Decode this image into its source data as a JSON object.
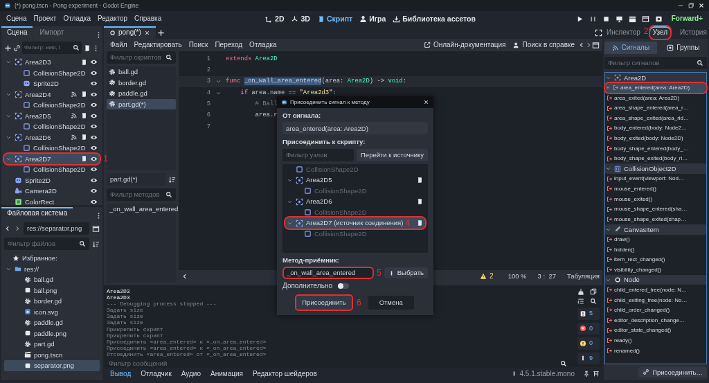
{
  "window": {
    "title": "(*) pong.tscn - Pong experiment - Godot Engine"
  },
  "menu": [
    "Сцена",
    "Проект",
    "Отладка",
    "Редактор",
    "Справка"
  ],
  "workspaces": [
    {
      "label": "2D",
      "kind": "flat",
      "selected": false
    },
    {
      "label": "3D",
      "kind": "spatial",
      "selected": false
    },
    {
      "label": "Скрипт",
      "kind": "script",
      "selected": true
    },
    {
      "label": "Игра",
      "kind": "game",
      "selected": false
    },
    {
      "label": "Библиотека ассетов",
      "kind": "assetlib",
      "selected": false
    }
  ],
  "renderer": "Forward+",
  "scene_dock": {
    "tabs": [
      {
        "label": "Сцена",
        "selected": true
      },
      {
        "label": "Импорт",
        "selected": false
      }
    ],
    "filter_placeholder": "Фильтр: имя, t",
    "tree": [
      {
        "name": "Area2D3",
        "kind": "area",
        "script": true,
        "signals": false,
        "selected": false,
        "circled": false,
        "expanded": true,
        "children": [
          {
            "name": "CollisionShape2D",
            "kind": "collision",
            "script": false,
            "signals": false,
            "selected": false,
            "circled": false
          },
          {
            "name": "Sprite2D",
            "kind": "sprite",
            "script": false,
            "signals": false,
            "selected": false,
            "circled": false
          }
        ]
      },
      {
        "name": "Area2D4",
        "kind": "area",
        "script": true,
        "signals": true,
        "selected": false,
        "circled": false,
        "expanded": true,
        "children": [
          {
            "name": "CollisionShape2D",
            "kind": "collision",
            "script": false,
            "signals": false,
            "selected": false,
            "circled": false
          }
        ]
      },
      {
        "name": "Area2D5",
        "kind": "area",
        "script": true,
        "signals": true,
        "selected": false,
        "circled": false,
        "expanded": true,
        "children": [
          {
            "name": "CollisionShape2D",
            "kind": "collision",
            "script": false,
            "signals": false,
            "selected": false,
            "circled": false
          }
        ]
      },
      {
        "name": "Area2D6",
        "kind": "area",
        "script": true,
        "signals": true,
        "selected": false,
        "circled": false,
        "expanded": true,
        "children": [
          {
            "name": "CollisionShape2D",
            "kind": "collision",
            "script": false,
            "signals": false,
            "selected": false,
            "circled": false
          }
        ]
      },
      {
        "name": "Area2D7",
        "kind": "area",
        "script": true,
        "signals": false,
        "selected": true,
        "circled": true,
        "annotation": "1",
        "expanded": true,
        "children": [
          {
            "name": "CollisionShape2D",
            "kind": "collision",
            "script": false,
            "signals": false,
            "selected": false,
            "circled": false
          }
        ]
      },
      {
        "name": "Sprite2D",
        "kind": "sprite",
        "script": false,
        "signals": false,
        "selected": false,
        "circled": false
      },
      {
        "name": "Camera2D",
        "kind": "camera",
        "script": false,
        "signals": false,
        "selected": false,
        "circled": false
      },
      {
        "name": "ColorRect",
        "kind": "colorrect",
        "script": false,
        "signals": false,
        "selected": false,
        "circled": false
      }
    ]
  },
  "filesystem": {
    "tab": "Файловая система",
    "path": "res://separator.png",
    "filter_placeholder": "Фильтр файлов",
    "favorites": "Избранное:",
    "tree": [
      {
        "name": "res://",
        "kind": "folder",
        "selected": false,
        "expanded": true,
        "children": [
          {
            "name": "ball.gd",
            "kind": "script",
            "selected": false
          },
          {
            "name": "ball.png",
            "kind": "image",
            "selected": false
          },
          {
            "name": "border.gd",
            "kind": "script",
            "selected": false
          },
          {
            "name": "icon.svg",
            "kind": "svg",
            "selected": false
          },
          {
            "name": "paddle.gd",
            "kind": "script",
            "selected": false
          },
          {
            "name": "paddle.png",
            "kind": "image",
            "selected": false
          },
          {
            "name": "part.gd",
            "kind": "script",
            "selected": false
          },
          {
            "name": "pong.tscn",
            "kind": "scene",
            "selected": false
          },
          {
            "name": "separator.png",
            "kind": "image",
            "selected": true
          }
        ]
      }
    ]
  },
  "editor_tabs": [
    {
      "label": "pong(*)",
      "selected": true
    }
  ],
  "script_menu": [
    "Файл",
    "Редактировать",
    "Поиск",
    "Переход",
    "Отладка"
  ],
  "help_links": [
    {
      "label": "Онлайн-документация",
      "kind": "docs"
    },
    {
      "label": "Поиск в справке",
      "kind": "search"
    }
  ],
  "script_list": {
    "filter_placeholder": "Фильтр скриптов",
    "files": [
      {
        "name": "ball.gd",
        "selected": false
      },
      {
        "name": "border.gd",
        "selected": false
      },
      {
        "name": "paddle.gd",
        "selected": false
      },
      {
        "name": "part.gd(*)",
        "selected": true
      }
    ],
    "current": "part.gd(*)",
    "method_filter_placeholder": "Фильтр методов",
    "methods": [
      "_on_wall_area_entered"
    ]
  },
  "code": [
    {
      "number": "1",
      "current": false,
      "foldable": false,
      "tokens": [
        {
          "text": "extends ",
          "kind": "keyword"
        },
        {
          "text": "Area2D",
          "kind": "type"
        }
      ]
    },
    {
      "number": "2",
      "current": false,
      "foldable": false
    },
    {
      "number": "3",
      "current": true,
      "foldable": true,
      "tokens": [
        {
          "text": "func ",
          "kind": "keyword"
        },
        {
          "text": "_on_wall_area_entered",
          "kind": "selection"
        },
        {
          "text": "(area: ",
          "kind": "plain"
        },
        {
          "text": "Area2D",
          "kind": "type"
        },
        {
          "text": ") -> ",
          "kind": "plain"
        },
        {
          "text": "void",
          "kind": "type"
        },
        {
          "text": ":",
          "kind": "plain"
        }
      ]
    },
    {
      "number": "4",
      "current": false,
      "foldable": true,
      "tokens": [
        {
          "text": "\tif",
          "kind": "control"
        },
        {
          "text": " area.name == ",
          "kind": "plain"
        },
        {
          "text": "\"Area2d3\"",
          "kind": "string"
        },
        {
          "text": ":",
          "kind": "plain"
        }
      ]
    },
    {
      "number": "5",
      "current": false,
      "foldable": false,
      "tokens": [
        {
          "text": "\t\t# Ball",
          "kind": "comment"
        }
      ]
    },
    {
      "number": "6",
      "current": false,
      "foldable": false,
      "tokens": [
        {
          "text": "\t\tarea.r",
          "kind": "plain"
        }
      ]
    },
    {
      "number": "7",
      "current": false,
      "foldable": false
    }
  ],
  "status": {
    "warnings": "2",
    "zoom": "100 %",
    "position": "3 :  27",
    "indent": "Табуляция"
  },
  "output": {
    "lines": [
      {
        "text": "Area2D3",
        "kind": "print"
      },
      {
        "text": "Area2D3",
        "kind": "print"
      },
      {
        "text": "--- Debugging process stopped ---",
        "kind": "editor"
      },
      {
        "text": "Задать size",
        "kind": "editor"
      },
      {
        "text": "Задать size",
        "kind": "editor"
      },
      {
        "text": "Задать size",
        "kind": "editor"
      },
      {
        "text": "Прикрепить скрипт",
        "kind": "editor"
      },
      {
        "text": "Прикрепить скрипт",
        "kind": "editor"
      },
      {
        "text": "Присоединить «area_entered» к «_on_area_entered»",
        "kind": "editor"
      },
      {
        "text": "Присоединить «area_entered» к «_on_area_entered»",
        "kind": "editor"
      },
      {
        "text": "Отсоединить «area_entered» от «_on_area_entered»",
        "kind": "editor"
      }
    ],
    "filter_placeholder": "Фильтр сообщений",
    "counters": [
      {
        "kind": "message",
        "count": "5"
      },
      {
        "kind": "error",
        "count": "0"
      },
      {
        "kind": "warning",
        "count": "0"
      },
      {
        "kind": "editor",
        "count": "9"
      }
    ]
  },
  "bottom_tabs": [
    {
      "label": "Вывод",
      "selected": true
    },
    {
      "label": "Отладчик",
      "selected": false
    },
    {
      "label": "Аудио",
      "selected": false
    },
    {
      "label": "Анимация",
      "selected": false
    },
    {
      "label": "Редактор шейдеров",
      "selected": false
    }
  ],
  "version": "4.5.1.stable.mono",
  "right_dock": {
    "tabs": [
      {
        "label": "Инспектор",
        "selected": false,
        "circled": false
      },
      {
        "label": "Узел",
        "selected": true,
        "circled": true,
        "annotation": "2"
      },
      {
        "label": "История",
        "selected": false,
        "circled": false
      }
    ],
    "subtabs": [
      {
        "label": "Сигналы",
        "kind": "signals",
        "selected": true
      },
      {
        "label": "Группы",
        "kind": "groups",
        "selected": false
      }
    ],
    "filter_placeholder": "Фильтр сигналов",
    "groups": [
      {
        "name": "Area2D",
        "kind": "area",
        "expanded": true,
        "signals": [
          {
            "label": "area_entered(area: Area2D)",
            "selected": true,
            "connected": true,
            "circled": true
          },
          {
            "label": "area_exited(area: Area2D)",
            "selected": false,
            "connected": false,
            "circled": false
          },
          {
            "label": "area_shape_entered(area_r…",
            "selected": false,
            "connected": false,
            "circled": false
          },
          {
            "label": "area_shape_exited(area_rid…",
            "selected": false,
            "connected": false,
            "circled": false
          },
          {
            "label": "body_entered(body: Node2…",
            "selected": false,
            "connected": false,
            "circled": false
          },
          {
            "label": "body_exited(body: Node2D)",
            "selected": false,
            "connected": false,
            "circled": false
          },
          {
            "label": "body_shape_entered(body_…",
            "selected": false,
            "connected": false,
            "circled": false
          },
          {
            "label": "body_shape_exited(body_ri…",
            "selected": false,
            "connected": false,
            "circled": false
          }
        ]
      },
      {
        "name": "CollisionObject2D",
        "kind": "collisionobject",
        "expanded": true,
        "signals": [
          {
            "label": "input_event(viewport: Nod…",
            "selected": false,
            "connected": false,
            "circled": false
          },
          {
            "label": "mouse_entered()",
            "selected": false,
            "connected": false,
            "circled": false
          },
          {
            "label": "mouse_exited()",
            "selected": false,
            "connected": false,
            "circled": false
          },
          {
            "label": "mouse_shape_entered(sha…",
            "selected": false,
            "connected": false,
            "circled": false
          },
          {
            "label": "mouse_shape_exited(shap…",
            "selected": false,
            "connected": false,
            "circled": false
          }
        ]
      },
      {
        "name": "CanvasItem",
        "kind": "canvasitem",
        "expanded": true,
        "signals": [
          {
            "label": "draw()",
            "selected": false,
            "connected": false,
            "circled": false
          },
          {
            "label": "hidden()",
            "selected": false,
            "connected": false,
            "circled": false
          },
          {
            "label": "item_rect_changed()",
            "selected": false,
            "connected": false,
            "circled": false
          },
          {
            "label": "visibility_changed()",
            "selected": false,
            "connected": false,
            "circled": false
          }
        ]
      },
      {
        "name": "Node",
        "kind": "node",
        "expanded": true,
        "signals": [
          {
            "label": "child_entered_tree(node: N…",
            "selected": false,
            "connected": false,
            "circled": false
          },
          {
            "label": "child_exiting_tree(node: No…",
            "selected": false,
            "connected": false,
            "circled": false
          },
          {
            "label": "child_order_changed()",
            "selected": false,
            "connected": false,
            "circled": false
          },
          {
            "label": "editor_description_change…",
            "selected": false,
            "connected": false,
            "circled": false
          },
          {
            "label": "editor_state_changed()",
            "selected": false,
            "connected": false,
            "circled": false
          },
          {
            "label": "ready()",
            "selected": false,
            "connected": false,
            "circled": false
          },
          {
            "label": "renamed()",
            "selected": false,
            "connected": false,
            "circled": false
          }
        ]
      }
    ],
    "connect_button": "Присоединить…"
  },
  "dialog": {
    "title": "Присоединить сигнал к методу",
    "from_label": "От сигнала:",
    "signal": "area_entered(area: Area2D)",
    "to_label": "Присоединить к скрипту:",
    "node_filter_placeholder": "Фильтр узлов",
    "go_to_source": "Перейти к источнику",
    "tree": [
      {
        "name": "CollisionShape2D",
        "kind": "collision",
        "disabled": true,
        "script": false,
        "selected": false,
        "circled": false
      },
      {
        "name": "Area2D5",
        "kind": "area",
        "disabled": false,
        "script": true,
        "selected": false,
        "circled": false,
        "expanded": true,
        "children": [
          {
            "name": "CollisionShape2D",
            "kind": "collision",
            "disabled": true,
            "script": false,
            "selected": false,
            "circled": false
          }
        ]
      },
      {
        "name": "Area2D6",
        "kind": "area",
        "disabled": false,
        "script": true,
        "selected": false,
        "circled": false,
        "expanded": true,
        "children": [
          {
            "name": "CollisionShape2D",
            "kind": "collision",
            "disabled": true,
            "script": false,
            "selected": false,
            "circled": false
          }
        ]
      },
      {
        "name": "Area2D7 (источник соединения)",
        "kind": "area",
        "disabled": false,
        "script": true,
        "selected": true,
        "circled": true,
        "annotation": "4",
        "expanded": true,
        "children": [
          {
            "name": "CollisionShape2D",
            "kind": "collision",
            "disabled": true,
            "script": false,
            "selected": false,
            "circled": false
          }
        ]
      }
    ],
    "method_label": "Метод-приёмник:",
    "method": "_on_wall_area_entered",
    "method_circled": true,
    "method_annotation": "5",
    "pick": "Выбрать",
    "advanced": "Дополнительно",
    "advanced_on": false,
    "connect": "Присоединить",
    "connect_circled": true,
    "connect_annotation": "6",
    "cancel": "Отмена"
  }
}
